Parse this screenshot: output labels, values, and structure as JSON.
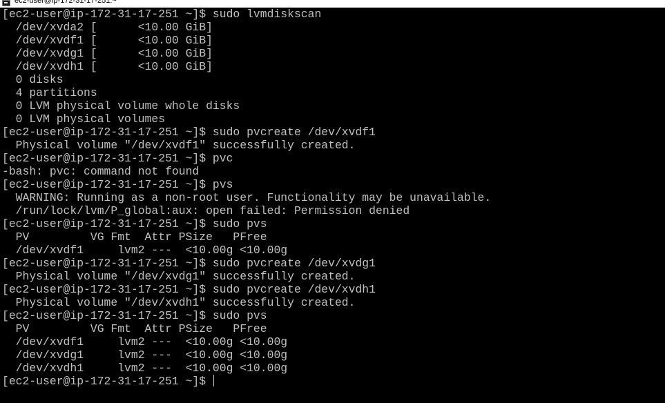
{
  "window": {
    "title": "ec2-user@ip-172-31-17-251:~"
  },
  "colors": {
    "background": "#000000",
    "foreground": "#c0c0c0",
    "titlebar": "#ffffff"
  },
  "terminal": {
    "lines": [
      "[ec2-user@ip-172-31-17-251 ~]$ sudo lvmdiskscan",
      "  /dev/xvda2 [      <10.00 GiB]",
      "  /dev/xvdf1 [      <10.00 GiB]",
      "  /dev/xvdg1 [      <10.00 GiB]",
      "  /dev/xvdh1 [      <10.00 GiB]",
      "  0 disks",
      "  4 partitions",
      "  0 LVM physical volume whole disks",
      "  0 LVM physical volumes",
      "[ec2-user@ip-172-31-17-251 ~]$ sudo pvcreate /dev/xvdf1",
      "  Physical volume \"/dev/xvdf1\" successfully created.",
      "[ec2-user@ip-172-31-17-251 ~]$ pvc",
      "-bash: pvc: command not found",
      "[ec2-user@ip-172-31-17-251 ~]$ pvs",
      "  WARNING: Running as a non-root user. Functionality may be unavailable.",
      "  /run/lock/lvm/P_global:aux: open failed: Permission denied",
      "[ec2-user@ip-172-31-17-251 ~]$ sudo pvs",
      "  PV         VG Fmt  Attr PSize   PFree",
      "  /dev/xvdf1     lvm2 ---  <10.00g <10.00g",
      "[ec2-user@ip-172-31-17-251 ~]$ sudo pvcreate /dev/xvdg1",
      "  Physical volume \"/dev/xvdg1\" successfully created.",
      "[ec2-user@ip-172-31-17-251 ~]$ sudo pvcreate /dev/xvdh1",
      "  Physical volume \"/dev/xvdh1\" successfully created.",
      "[ec2-user@ip-172-31-17-251 ~]$ sudo pvs",
      "  PV         VG Fmt  Attr PSize   PFree",
      "  /dev/xvdf1     lvm2 ---  <10.00g <10.00g",
      "  /dev/xvdg1     lvm2 ---  <10.00g <10.00g",
      "  /dev/xvdh1     lvm2 ---  <10.00g <10.00g"
    ],
    "prompt": "[ec2-user@ip-172-31-17-251 ~]$ "
  }
}
